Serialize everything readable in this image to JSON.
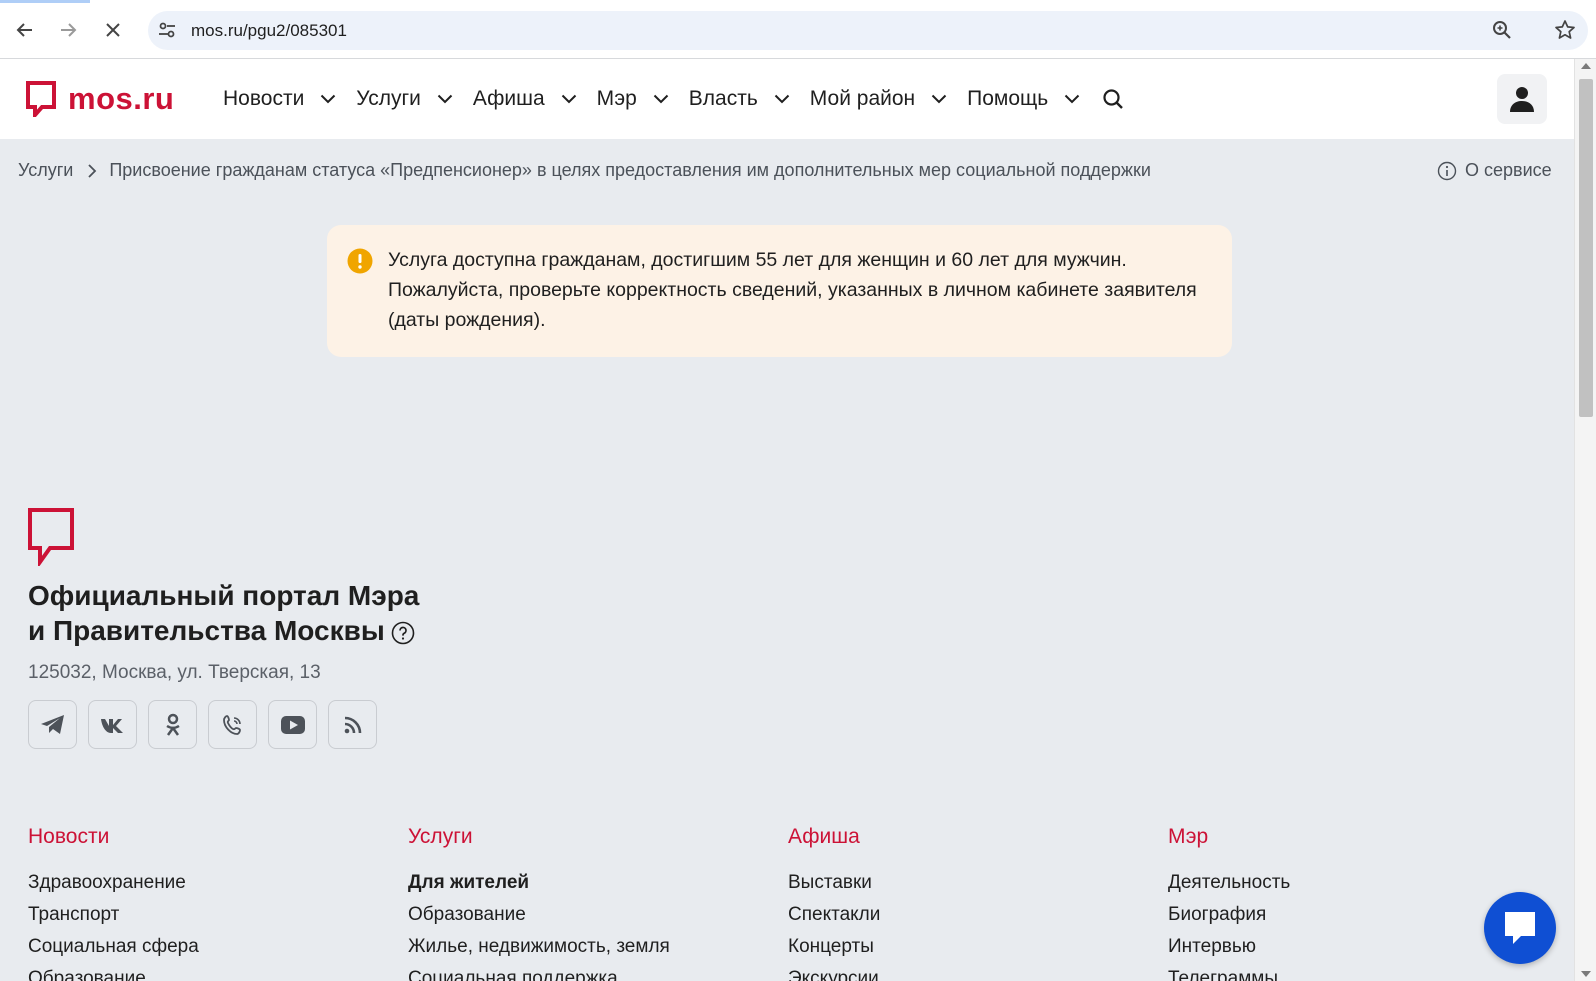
{
  "browser": {
    "url": "mos.ru/pgu2/085301"
  },
  "header": {
    "logo_text": "mos.ru",
    "menu": [
      {
        "label": "Новости"
      },
      {
        "label": "Услуги"
      },
      {
        "label": "Афиша"
      },
      {
        "label": "Мэр"
      },
      {
        "label": "Власть"
      },
      {
        "label": "Мой район"
      },
      {
        "label": "Помощь"
      }
    ]
  },
  "breadcrumb": {
    "root": "Услуги",
    "current": "Присвоение гражданам статуса «Предпенсионер» в целях предоставления им дополнительных мер социальной поддержки"
  },
  "about_label": "О сервисе",
  "alert": {
    "text": "Услуга доступна гражданам, достигшим 55 лет для женщин и 60 лет для мужчин. Пожалуйста, проверьте корректность сведений, указанных в личном кабинете заявителя (даты рождения)."
  },
  "footer": {
    "title_line1": "Официальный портал Мэра",
    "title_line2": "и Правительства Москвы",
    "address": "125032, Москва, ул. Тверская, 13",
    "socials": [
      "telegram-icon",
      "vk-icon",
      "odnoklassniki-icon",
      "viber-icon",
      "youtube-icon",
      "rss-icon"
    ],
    "columns": [
      {
        "title": "Новости",
        "links": [
          "Здравоохранение",
          "Транспорт",
          "Социальная сфера",
          "Образование"
        ]
      },
      {
        "title": "Услуги",
        "links": [
          "Для жителей",
          "Образование",
          "Жилье, недвижимость, земля",
          "Социальная поддержка"
        ]
      },
      {
        "title": "Афиша",
        "links": [
          "Выставки",
          "Спектакли",
          "Концерты",
          "Экскурсии"
        ]
      },
      {
        "title": "Мэр",
        "links": [
          "Деятельность",
          "Биография",
          "Интервью",
          "Телеграммы"
        ]
      }
    ]
  },
  "colors": {
    "brand": "#cc1236",
    "alert_bg": "#fdf2e6",
    "alert_icon": "#f0a500",
    "chat": "#0f4fd3"
  }
}
